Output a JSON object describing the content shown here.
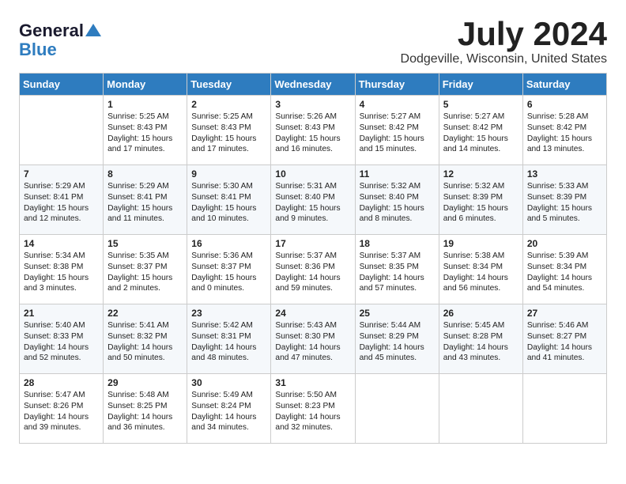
{
  "logo": {
    "general": "General",
    "blue": "Blue"
  },
  "title": "July 2024",
  "location": "Dodgeville, Wisconsin, United States",
  "weekdays": [
    "Sunday",
    "Monday",
    "Tuesday",
    "Wednesday",
    "Thursday",
    "Friday",
    "Saturday"
  ],
  "weeks": [
    [
      {
        "day": "",
        "sunrise": "",
        "sunset": "",
        "daylight": ""
      },
      {
        "day": "1",
        "sunrise": "Sunrise: 5:25 AM",
        "sunset": "Sunset: 8:43 PM",
        "daylight": "Daylight: 15 hours and 17 minutes."
      },
      {
        "day": "2",
        "sunrise": "Sunrise: 5:25 AM",
        "sunset": "Sunset: 8:43 PM",
        "daylight": "Daylight: 15 hours and 17 minutes."
      },
      {
        "day": "3",
        "sunrise": "Sunrise: 5:26 AM",
        "sunset": "Sunset: 8:43 PM",
        "daylight": "Daylight: 15 hours and 16 minutes."
      },
      {
        "day": "4",
        "sunrise": "Sunrise: 5:27 AM",
        "sunset": "Sunset: 8:42 PM",
        "daylight": "Daylight: 15 hours and 15 minutes."
      },
      {
        "day": "5",
        "sunrise": "Sunrise: 5:27 AM",
        "sunset": "Sunset: 8:42 PM",
        "daylight": "Daylight: 15 hours and 14 minutes."
      },
      {
        "day": "6",
        "sunrise": "Sunrise: 5:28 AM",
        "sunset": "Sunset: 8:42 PM",
        "daylight": "Daylight: 15 hours and 13 minutes."
      }
    ],
    [
      {
        "day": "7",
        "sunrise": "Sunrise: 5:29 AM",
        "sunset": "Sunset: 8:41 PM",
        "daylight": "Daylight: 15 hours and 12 minutes."
      },
      {
        "day": "8",
        "sunrise": "Sunrise: 5:29 AM",
        "sunset": "Sunset: 8:41 PM",
        "daylight": "Daylight: 15 hours and 11 minutes."
      },
      {
        "day": "9",
        "sunrise": "Sunrise: 5:30 AM",
        "sunset": "Sunset: 8:41 PM",
        "daylight": "Daylight: 15 hours and 10 minutes."
      },
      {
        "day": "10",
        "sunrise": "Sunrise: 5:31 AM",
        "sunset": "Sunset: 8:40 PM",
        "daylight": "Daylight: 15 hours and 9 minutes."
      },
      {
        "day": "11",
        "sunrise": "Sunrise: 5:32 AM",
        "sunset": "Sunset: 8:40 PM",
        "daylight": "Daylight: 15 hours and 8 minutes."
      },
      {
        "day": "12",
        "sunrise": "Sunrise: 5:32 AM",
        "sunset": "Sunset: 8:39 PM",
        "daylight": "Daylight: 15 hours and 6 minutes."
      },
      {
        "day": "13",
        "sunrise": "Sunrise: 5:33 AM",
        "sunset": "Sunset: 8:39 PM",
        "daylight": "Daylight: 15 hours and 5 minutes."
      }
    ],
    [
      {
        "day": "14",
        "sunrise": "Sunrise: 5:34 AM",
        "sunset": "Sunset: 8:38 PM",
        "daylight": "Daylight: 15 hours and 3 minutes."
      },
      {
        "day": "15",
        "sunrise": "Sunrise: 5:35 AM",
        "sunset": "Sunset: 8:37 PM",
        "daylight": "Daylight: 15 hours and 2 minutes."
      },
      {
        "day": "16",
        "sunrise": "Sunrise: 5:36 AM",
        "sunset": "Sunset: 8:37 PM",
        "daylight": "Daylight: 15 hours and 0 minutes."
      },
      {
        "day": "17",
        "sunrise": "Sunrise: 5:37 AM",
        "sunset": "Sunset: 8:36 PM",
        "daylight": "Daylight: 14 hours and 59 minutes."
      },
      {
        "day": "18",
        "sunrise": "Sunrise: 5:37 AM",
        "sunset": "Sunset: 8:35 PM",
        "daylight": "Daylight: 14 hours and 57 minutes."
      },
      {
        "day": "19",
        "sunrise": "Sunrise: 5:38 AM",
        "sunset": "Sunset: 8:34 PM",
        "daylight": "Daylight: 14 hours and 56 minutes."
      },
      {
        "day": "20",
        "sunrise": "Sunrise: 5:39 AM",
        "sunset": "Sunset: 8:34 PM",
        "daylight": "Daylight: 14 hours and 54 minutes."
      }
    ],
    [
      {
        "day": "21",
        "sunrise": "Sunrise: 5:40 AM",
        "sunset": "Sunset: 8:33 PM",
        "daylight": "Daylight: 14 hours and 52 minutes."
      },
      {
        "day": "22",
        "sunrise": "Sunrise: 5:41 AM",
        "sunset": "Sunset: 8:32 PM",
        "daylight": "Daylight: 14 hours and 50 minutes."
      },
      {
        "day": "23",
        "sunrise": "Sunrise: 5:42 AM",
        "sunset": "Sunset: 8:31 PM",
        "daylight": "Daylight: 14 hours and 48 minutes."
      },
      {
        "day": "24",
        "sunrise": "Sunrise: 5:43 AM",
        "sunset": "Sunset: 8:30 PM",
        "daylight": "Daylight: 14 hours and 47 minutes."
      },
      {
        "day": "25",
        "sunrise": "Sunrise: 5:44 AM",
        "sunset": "Sunset: 8:29 PM",
        "daylight": "Daylight: 14 hours and 45 minutes."
      },
      {
        "day": "26",
        "sunrise": "Sunrise: 5:45 AM",
        "sunset": "Sunset: 8:28 PM",
        "daylight": "Daylight: 14 hours and 43 minutes."
      },
      {
        "day": "27",
        "sunrise": "Sunrise: 5:46 AM",
        "sunset": "Sunset: 8:27 PM",
        "daylight": "Daylight: 14 hours and 41 minutes."
      }
    ],
    [
      {
        "day": "28",
        "sunrise": "Sunrise: 5:47 AM",
        "sunset": "Sunset: 8:26 PM",
        "daylight": "Daylight: 14 hours and 39 minutes."
      },
      {
        "day": "29",
        "sunrise": "Sunrise: 5:48 AM",
        "sunset": "Sunset: 8:25 PM",
        "daylight": "Daylight: 14 hours and 36 minutes."
      },
      {
        "day": "30",
        "sunrise": "Sunrise: 5:49 AM",
        "sunset": "Sunset: 8:24 PM",
        "daylight": "Daylight: 14 hours and 34 minutes."
      },
      {
        "day": "31",
        "sunrise": "Sunrise: 5:50 AM",
        "sunset": "Sunset: 8:23 PM",
        "daylight": "Daylight: 14 hours and 32 minutes."
      },
      {
        "day": "",
        "sunrise": "",
        "sunset": "",
        "daylight": ""
      },
      {
        "day": "",
        "sunrise": "",
        "sunset": "",
        "daylight": ""
      },
      {
        "day": "",
        "sunrise": "",
        "sunset": "",
        "daylight": ""
      }
    ]
  ]
}
